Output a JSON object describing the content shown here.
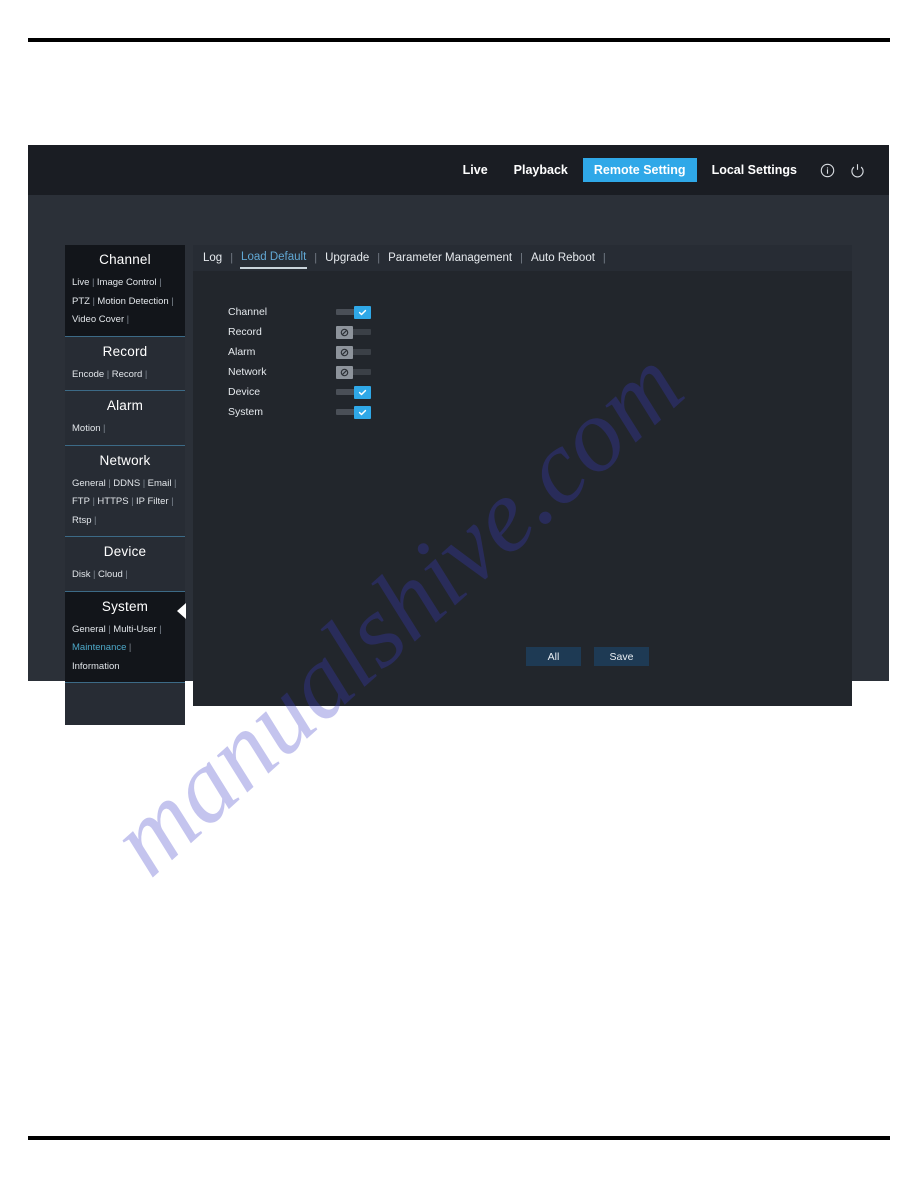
{
  "app": {
    "header": {
      "nav": [
        {
          "label": "Live",
          "active": false
        },
        {
          "label": "Playback",
          "active": false
        },
        {
          "label": "Remote Setting",
          "active": true
        },
        {
          "label": "Local Settings",
          "active": false
        }
      ],
      "icons": [
        {
          "name": "info-icon",
          "glyph": "i"
        },
        {
          "name": "power-icon",
          "glyph": "power"
        }
      ],
      "active_accent": "#2fa8e8"
    },
    "sidebar": {
      "groups": [
        {
          "title": "Channel",
          "active": true,
          "arrow": false,
          "links": [
            {
              "label": "Live",
              "active": false
            },
            {
              "label": "Image Control",
              "active": false
            },
            {
              "label": "PTZ",
              "active": false
            },
            {
              "label": "Motion Detection",
              "active": false
            },
            {
              "label": "Video Cover",
              "active": false
            }
          ],
          "line_breaks": [
            2,
            4
          ]
        },
        {
          "title": "Record",
          "active": false,
          "arrow": false,
          "links": [
            {
              "label": "Encode",
              "active": false
            },
            {
              "label": "Record",
              "active": false
            }
          ],
          "line_breaks": []
        },
        {
          "title": "Alarm",
          "active": false,
          "arrow": false,
          "links": [
            {
              "label": "Motion",
              "active": false
            }
          ],
          "line_breaks": []
        },
        {
          "title": "Network",
          "active": false,
          "arrow": false,
          "links": [
            {
              "label": "General",
              "active": false
            },
            {
              "label": "DDNS",
              "active": false
            },
            {
              "label": "Email",
              "active": false
            },
            {
              "label": "FTP",
              "active": false
            },
            {
              "label": "HTTPS",
              "active": false
            },
            {
              "label": "IP Filter",
              "active": false
            },
            {
              "label": "Rtsp",
              "active": false
            }
          ],
          "line_breaks": [
            3,
            6
          ]
        },
        {
          "title": "Device",
          "active": false,
          "arrow": false,
          "links": [
            {
              "label": "Disk",
              "active": false
            },
            {
              "label": "Cloud",
              "active": false
            }
          ],
          "line_breaks": []
        },
        {
          "title": "System",
          "active": true,
          "arrow": true,
          "links": [
            {
              "label": "General",
              "active": false
            },
            {
              "label": "Multi-User",
              "active": false
            },
            {
              "label": "Maintenance",
              "active": true
            },
            {
              "label": "Information",
              "active": false
            }
          ],
          "line_breaks": [
            2,
            3
          ],
          "no_trailing_sep_after": 3
        }
      ],
      "active_link_color": "#4da8c8"
    },
    "content": {
      "tabs": [
        {
          "label": "Log",
          "active": false
        },
        {
          "label": "Load Default",
          "active": true
        },
        {
          "label": "Upgrade",
          "active": false
        },
        {
          "label": "Parameter Management",
          "active": false
        },
        {
          "label": "Auto Reboot",
          "active": false
        }
      ],
      "toggles": [
        {
          "label": "Channel",
          "on": true
        },
        {
          "label": "Record",
          "on": false
        },
        {
          "label": "Alarm",
          "on": false
        },
        {
          "label": "Network",
          "on": false
        },
        {
          "label": "Device",
          "on": true
        },
        {
          "label": "System",
          "on": true
        }
      ],
      "buttons": [
        {
          "label": "All",
          "name": "all-button"
        },
        {
          "label": "Save",
          "name": "save-button"
        }
      ]
    }
  },
  "watermark": {
    "text": "manualshive.com",
    "color": "#3b3bc8"
  }
}
